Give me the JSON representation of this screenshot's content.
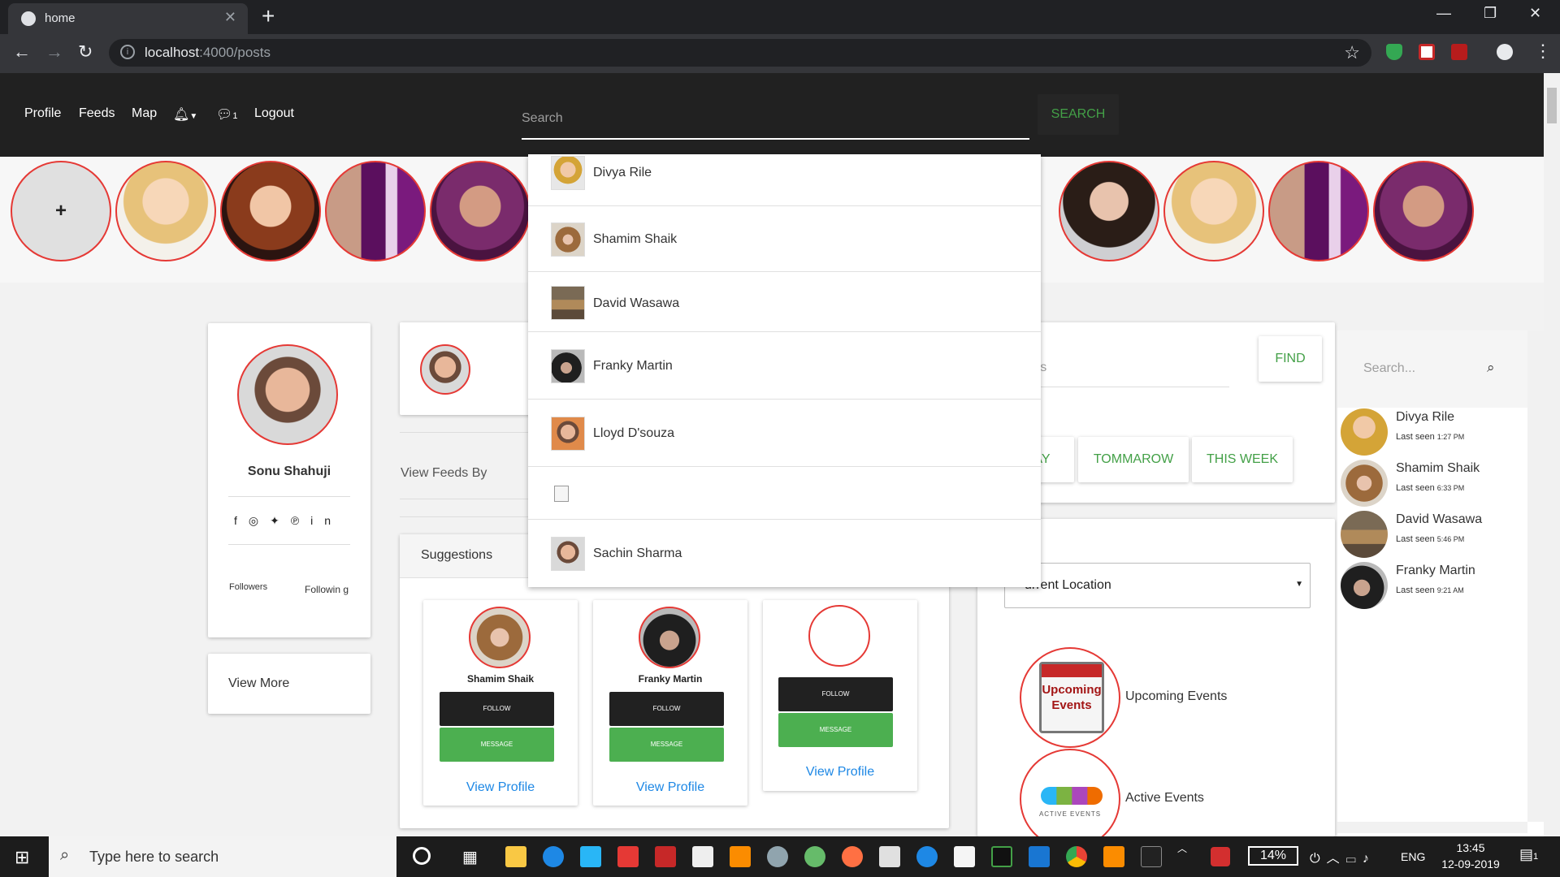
{
  "browser": {
    "tab_title": "home",
    "url_host": "localhost",
    "url_path": ":4000/posts"
  },
  "navbar": {
    "links": [
      "Profile",
      "Feeds",
      "Map"
    ],
    "notification_count": "1",
    "logout": "Logout",
    "search_placeholder": "Search",
    "search_button": "SEARCH"
  },
  "stories": {
    "add_label": "+"
  },
  "profile_card": {
    "name": "Sonu Shahuji",
    "followers_label": "Followers",
    "following_label": "Followin g"
  },
  "view_more": "View More",
  "feeds_filter_label": "View Feeds By",
  "suggestions": {
    "title": "Suggestions",
    "people": [
      {
        "name": "Shamim Shaik",
        "follow": "FOLLOW",
        "message": "MESSAGE",
        "view": "View Profile"
      },
      {
        "name": "Franky Martin",
        "follow": "FOLLOW",
        "message": "MESSAGE",
        "view": "View Profile"
      },
      {
        "name": "",
        "follow": "FOLLOW",
        "message": "MESSAGE",
        "view": "View Profile"
      }
    ]
  },
  "search_dropdown": [
    "Divya Rile",
    "Shamim Shaik",
    "David Wasawa",
    "Franky Martin",
    "Lloyd D'souza",
    "",
    "Sachin Sharma"
  ],
  "events": {
    "input_placeholder_visible": "ents",
    "find_button": "FIND",
    "filters": [
      "AY",
      "TOMMAROW",
      "THIS WEEK"
    ],
    "location_select": "urrent Location",
    "upcoming_logo_text": "Upcoming Events",
    "upcoming_label": "Upcoming Events",
    "active_logo_text": "ACTIVE EVENTS",
    "active_label": "Active Events"
  },
  "chat": {
    "search_placeholder": "Search...",
    "users": [
      {
        "name": "Divya Rile",
        "seen": "Last seen",
        "time": "1:27 PM"
      },
      {
        "name": "Shamim Shaik",
        "seen": "Last seen",
        "time": "6:33 PM"
      },
      {
        "name": "David Wasawa",
        "seen": "Last seen",
        "time": "5:46 PM"
      },
      {
        "name": "Franky Martin",
        "seen": "Last seen",
        "time": "9:21 AM"
      }
    ]
  },
  "taskbar": {
    "search_placeholder": "Type here to search",
    "battery": "14%",
    "language": "ENG",
    "time": "13:45",
    "date": "12-09-2019",
    "notification_count": "1"
  },
  "colors": {
    "navbar": "#212121",
    "accent_red": "#e53935",
    "green": "#4caf50",
    "link_blue": "#1e88e5"
  }
}
